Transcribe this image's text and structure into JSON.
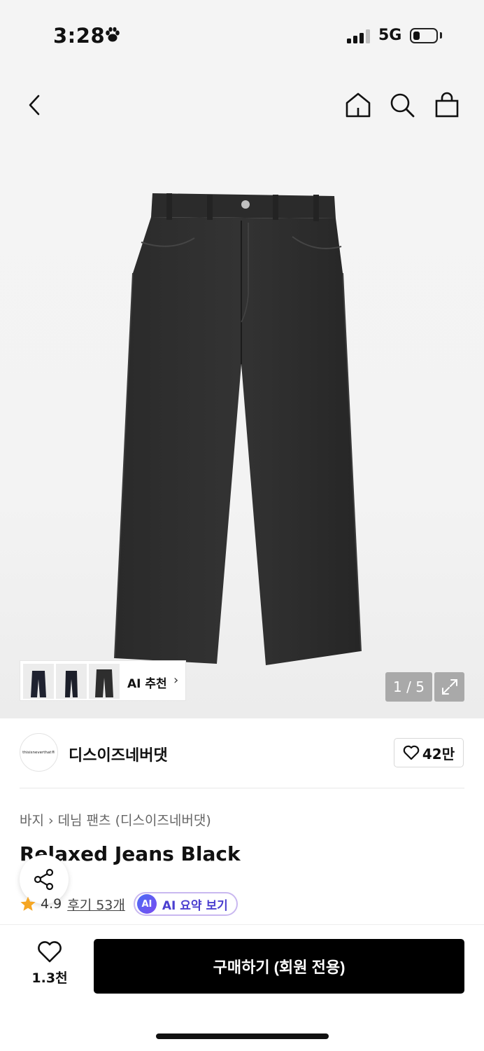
{
  "status_bar": {
    "time": "3:28",
    "network": "5G",
    "icons": [
      "paw-icon",
      "signal-icon",
      "battery-icon"
    ]
  },
  "header": {
    "icons": [
      "back-icon",
      "home-icon",
      "search-icon",
      "cart-icon"
    ]
  },
  "gallery": {
    "counter": "1 / 5",
    "ai_recommend_label": "AI 추천",
    "expand_icon": "expand-icon"
  },
  "brand": {
    "logo_text": "thisisneverthat®",
    "name": "디스이즈네버댓",
    "likes": "42만"
  },
  "product": {
    "breadcrumb": [
      "바지",
      "데님 팬츠 (디스이즈네버댓)"
    ],
    "title": "Relaxed Jeans Black",
    "rating": "4.9",
    "reviews": "후기 53개",
    "ai_badge": "AI",
    "ai_summary": "AI 요약 보기"
  },
  "bottom_bar": {
    "wish_count": "1.3천",
    "buy_label": "구매하기 (회원 전용)"
  },
  "colors": {
    "buy_button": "#000000",
    "star": "#f5a623",
    "ai_accent": "#4b3fd0",
    "counter_bg": "#a9a9a9"
  }
}
